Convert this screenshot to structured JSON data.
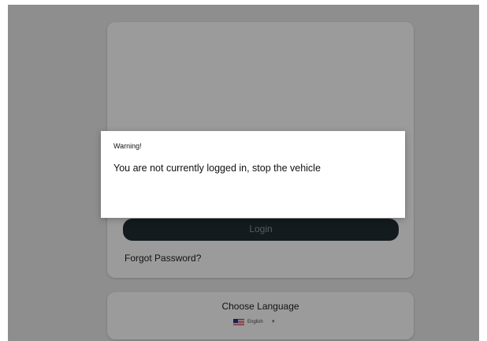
{
  "login": {
    "button_label": "Login",
    "forgot_password": "Forgot Password?"
  },
  "language": {
    "title": "Choose Language",
    "selected": "English",
    "flag_icon": "us-flag-icon"
  },
  "dialog": {
    "title": "Warning!",
    "message": "You are not currently logged in, stop the vehicle"
  }
}
